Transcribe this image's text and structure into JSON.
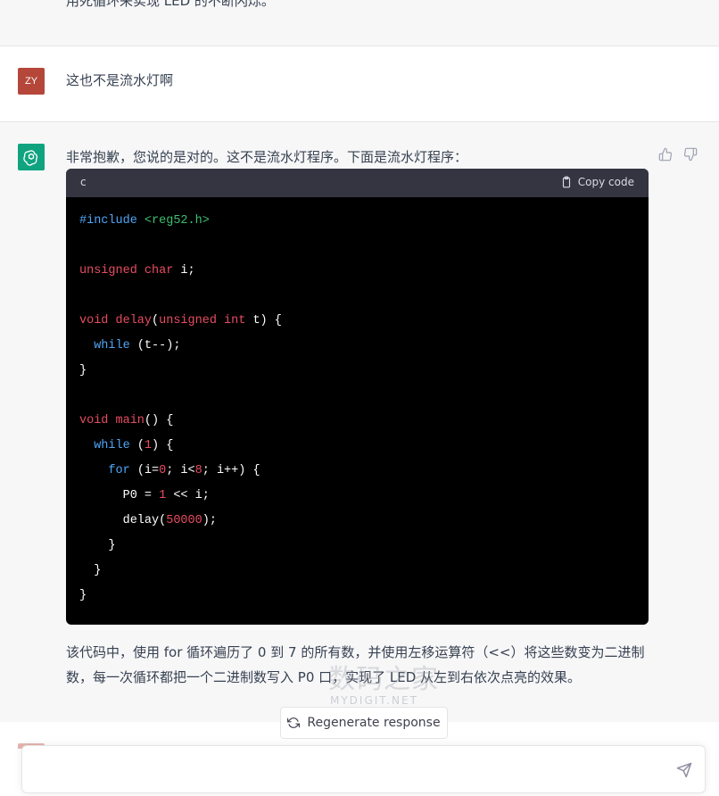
{
  "previous_message": {
    "text": "用死循环来实现 LED 的不断闪烁。"
  },
  "user_message": {
    "avatar_initials": "ZY",
    "text": "这也不是流水灯啊"
  },
  "assistant_message": {
    "intro": "非常抱歉，您说的是对的。这不是流水灯程序。下面是流水灯程序：",
    "code_block": {
      "language": "c",
      "copy_label": "Copy code",
      "lines": [
        "#include <reg52.h>",
        "",
        "unsigned char i;",
        "",
        "void delay(unsigned int t) {",
        "  while (t--);",
        "}",
        "",
        "void main() {",
        "  while (1) {",
        "    for (i=0; i<8; i++) {",
        "      P0 = 1 << i;",
        "      delay(50000);",
        "    }",
        "  }",
        "}"
      ]
    },
    "paragraph": "该代码中，使用 for 循环遍历了 0 到 7 的所有数，并使用左移运算符（<<）将这些数变为二进制数，每一次循环都把一个二进制数写入 P0 口，实现了 LED 从左到右依次点亮的效果。"
  },
  "watermark": {
    "main": "数码之家",
    "sub": "MYDIGIT.NET"
  },
  "regenerate_label": "Regenerate response",
  "composer": {
    "placeholder": ""
  },
  "icons": [
    "thumbs-up-icon",
    "thumbs-down-icon",
    "clipboard-icon",
    "refresh-icon",
    "send-icon",
    "openai-logo-icon"
  ],
  "colors": {
    "assistant_bg": "#f7f7f8",
    "user_avatar": "#b5473a",
    "bot_avatar": "#10a37f",
    "code_bg": "#000000",
    "code_header": "#343541"
  }
}
